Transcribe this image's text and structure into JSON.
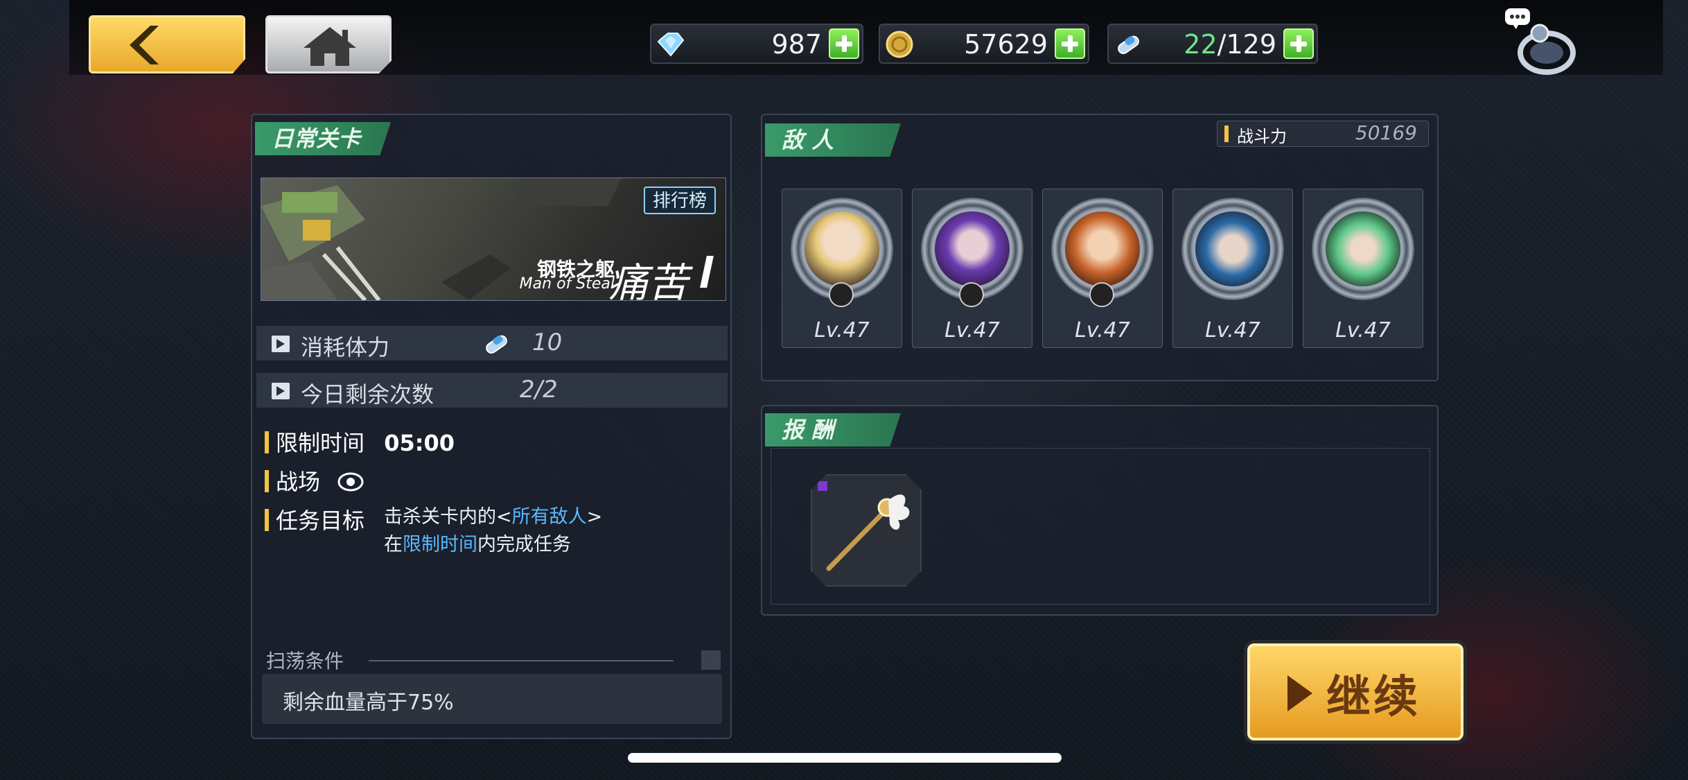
{
  "topbar": {
    "back_icon": "chevron-left-icon",
    "home_icon": "home-icon",
    "gems": {
      "icon": "gem-icon",
      "value": "987"
    },
    "gold": {
      "icon": "coin-icon",
      "value": "57629"
    },
    "stamina": {
      "icon": "stamina-icon",
      "current": "22",
      "max_text": "/129"
    },
    "profile_icon": "chat-profile-icon"
  },
  "stage": {
    "section_title": "日常关卡",
    "ranking_label": "排行榜",
    "title_cn": "钢铁之躯",
    "title_en": "Man of Steal",
    "difficulty": "痛苦",
    "stamina_cost_label": "消耗体力",
    "stamina_cost_value": "10",
    "remaining_label": "今日剩余次数",
    "remaining_value": "2/2",
    "time_limit_label": "限制时间",
    "time_limit_value": "05:00",
    "battlefield_label": "战场",
    "objective_label": "任务目标",
    "objective_line1_a": "击杀关卡内的<",
    "objective_line1_hl": "所有敌人",
    "objective_line1_b": ">",
    "objective_line2_a": "在",
    "objective_line2_hl": "限制时间",
    "objective_line2_b": "内完成任务",
    "sweep_label": "扫荡条件",
    "sweep_condition": "剩余血量高于75%"
  },
  "enemies": {
    "section_title": "敌 人",
    "power_label": "战斗力",
    "power_value": "50169",
    "list": [
      {
        "level": "Lv.47",
        "has_badge": true
      },
      {
        "level": "Lv.47",
        "has_badge": true
      },
      {
        "level": "Lv.47",
        "has_badge": true
      },
      {
        "level": "Lv.47",
        "has_badge": false
      },
      {
        "level": "Lv.47",
        "has_badge": false
      }
    ]
  },
  "rewards": {
    "section_title": "报 酬",
    "items": [
      {
        "icon": "staff-weapon-icon"
      }
    ]
  },
  "continue_label": "继续",
  "colors": {
    "accent_green": "#3a9a6a",
    "gold": "#f2c53d",
    "highlight_blue": "#5ab9ff"
  }
}
